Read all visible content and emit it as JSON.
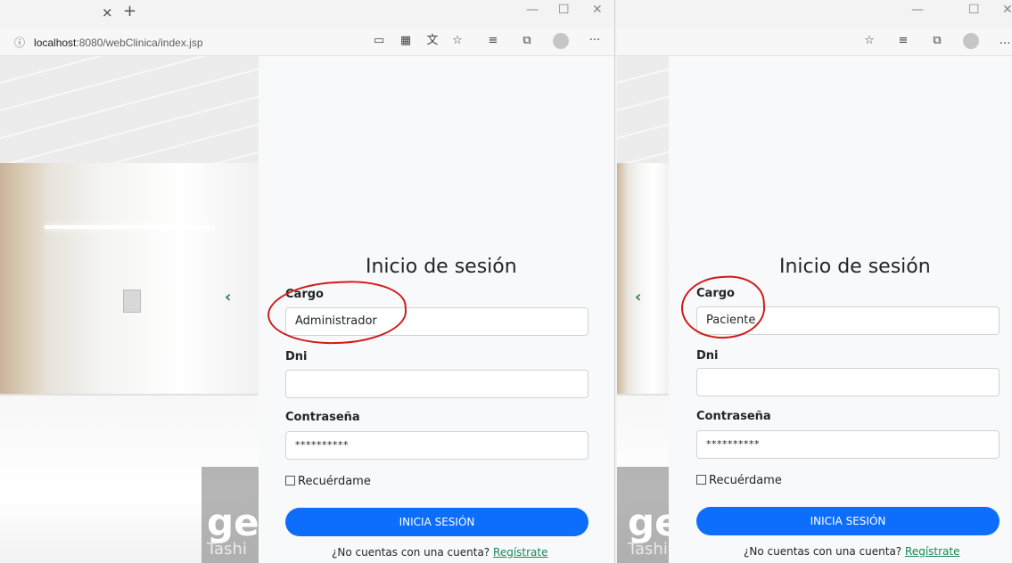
{
  "browser": {
    "close_tab_glyph": "×",
    "new_tab_glyph": "+",
    "url_info_icon": "ⓘ",
    "url_host": "localhost",
    "url_path": ":8080/webClinica/index.jsp",
    "minimize_glyph": "—",
    "maximize_glyph": "☐",
    "close_glyph": "✕",
    "more_glyph": "···",
    "ellipsis_right": "…"
  },
  "background": {
    "watermark_big": "get",
    "watermark_small": "Tashi",
    "carousel_prev_glyph": "‹"
  },
  "login_left": {
    "title": "Inicio de sesión",
    "cargo_label": "Cargo",
    "cargo_value": "Administrador",
    "dni_label": "Dni",
    "dni_value": "",
    "password_label": "Contraseña",
    "password_value": "**********",
    "remember_label": "Recuérdame",
    "submit_label": "INICIA SESIÓN",
    "footer_text": "¿No cuentas con una cuenta?",
    "register_link": "Regístrate"
  },
  "login_right": {
    "title": "Inicio de sesión",
    "cargo_label": "Cargo",
    "cargo_value": "Paciente",
    "dni_label": "Dni",
    "dni_value": "",
    "password_label": "Contraseña",
    "password_value": "**********",
    "remember_label": "Recuérdame",
    "submit_label": "INICIA SESIÓN",
    "footer_text": "¿No cuentas con una cuenta?",
    "register_link": "Regístrate"
  },
  "colors": {
    "primary_button": "#0d6efd",
    "link": "#198754",
    "annotation_red": "#d11a1a",
    "panel_bg": "#f8f9fa"
  }
}
